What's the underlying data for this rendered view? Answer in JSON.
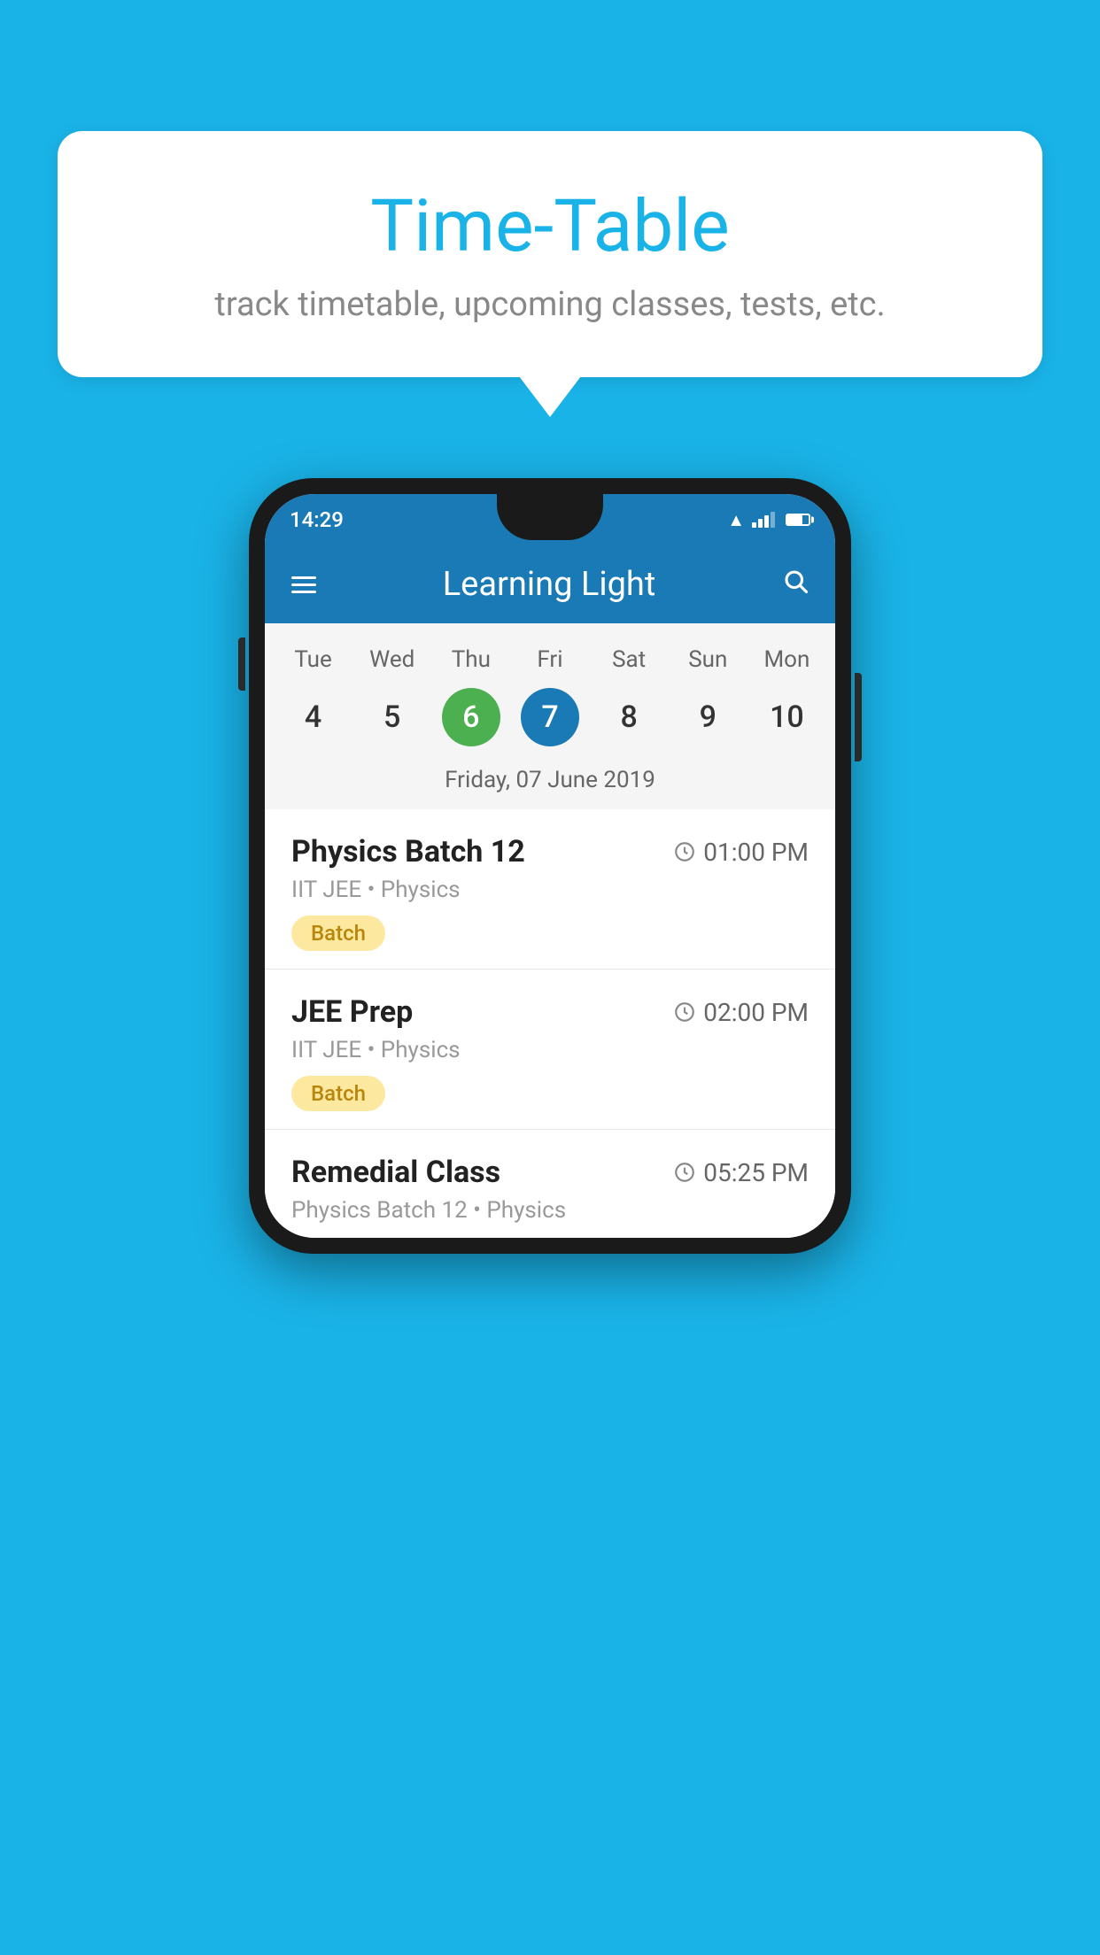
{
  "background_color": "#1ab3e8",
  "speech_bubble": {
    "title": "Time-Table",
    "subtitle": "track timetable, upcoming classes, tests, etc."
  },
  "phone": {
    "status_bar": {
      "time": "14:29"
    },
    "app_header": {
      "title": "Learning Light"
    },
    "calendar": {
      "days": [
        "Tue",
        "Wed",
        "Thu",
        "Fri",
        "Sat",
        "Sun",
        "Mon"
      ],
      "dates": [
        "4",
        "5",
        "6",
        "7",
        "8",
        "9",
        "10"
      ],
      "today_index": 2,
      "selected_index": 3,
      "selected_date_label": "Friday, 07 June 2019"
    },
    "schedule": [
      {
        "title": "Physics Batch 12",
        "time": "01:00 PM",
        "subtitle": "IIT JEE • Physics",
        "tag": "Batch"
      },
      {
        "title": "JEE Prep",
        "time": "02:00 PM",
        "subtitle": "IIT JEE • Physics",
        "tag": "Batch"
      },
      {
        "title": "Remedial Class",
        "time": "05:25 PM",
        "subtitle": "Physics Batch 12 • Physics",
        "tag": null
      }
    ]
  }
}
